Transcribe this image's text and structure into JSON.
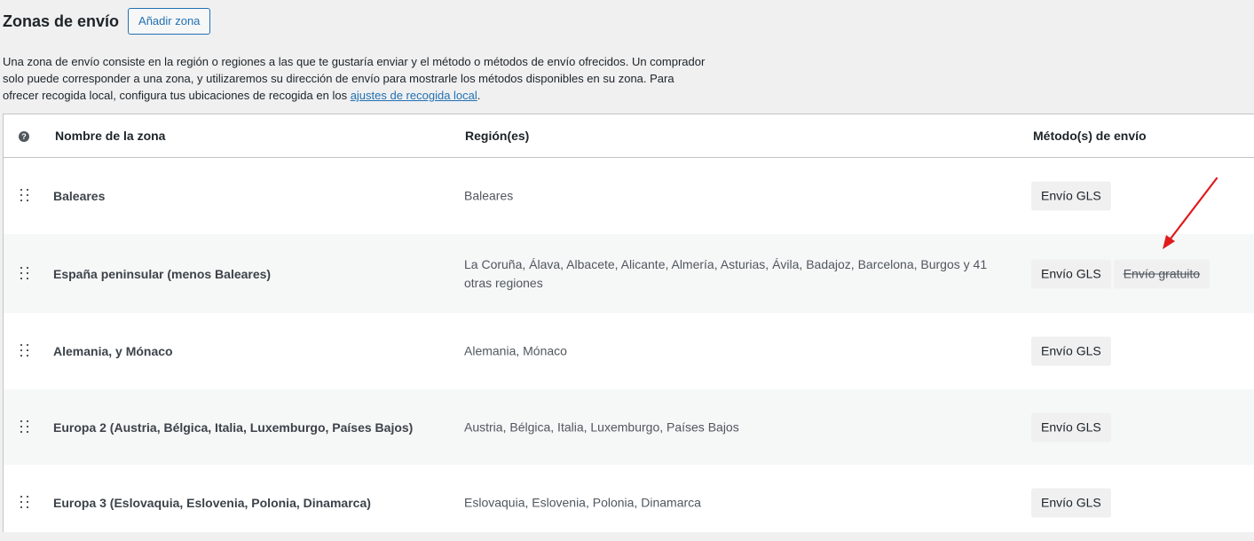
{
  "header": {
    "title": "Zonas de envío",
    "add_button": "Añadir zona"
  },
  "description": {
    "text_before_link": "Una zona de envío consiste en la región o regiones a las que te gustaría enviar y el método o métodos de envío ofrecidos. Un comprador solo puede corresponder a una zona, y utilizaremos su dirección de envío para mostrarle los métodos disponibles en su zona. Para ofrecer recogida local, configura tus ubicaciones de recogida en los ",
    "link_text": "ajustes de recogida local",
    "text_after_link": "."
  },
  "table": {
    "help_icon": "?",
    "columns": {
      "name": "Nombre de la zona",
      "region": "Región(es)",
      "methods": "Método(s) de envío"
    },
    "rows": [
      {
        "name": "Baleares",
        "region": "Baleares",
        "methods": [
          {
            "label": "Envío GLS",
            "disabled": false
          }
        ]
      },
      {
        "name": "España peninsular (menos Baleares)",
        "region": "La Coruña, Álava, Albacete, Alicante, Almería, Asturias, Ávila, Badajoz, Barcelona, Burgos y 41 otras regiones",
        "methods": [
          {
            "label": "Envío GLS",
            "disabled": false
          },
          {
            "label": "Envío gratuito",
            "disabled": true
          }
        ]
      },
      {
        "name": "Alemania, y Mónaco",
        "region": "Alemania, Mónaco",
        "methods": [
          {
            "label": "Envío GLS",
            "disabled": false
          }
        ]
      },
      {
        "name": "Europa 2 (Austria, Bélgica, Italia, Luxemburgo, Países Bajos)",
        "region": "Austria, Bélgica, Italia, Luxemburgo, Países Bajos",
        "methods": [
          {
            "label": "Envío GLS",
            "disabled": false
          }
        ]
      },
      {
        "name": "Europa 3 (Eslovaquia, Eslovenia, Polonia, Dinamarca)",
        "region": "Eslovaquia, Eslovenia, Polonia, Dinamarca",
        "methods": [
          {
            "label": "Envío GLS",
            "disabled": false
          }
        ]
      }
    ]
  },
  "annotation": {
    "icon": "red-arrow-icon",
    "color": "#e01b1b"
  }
}
